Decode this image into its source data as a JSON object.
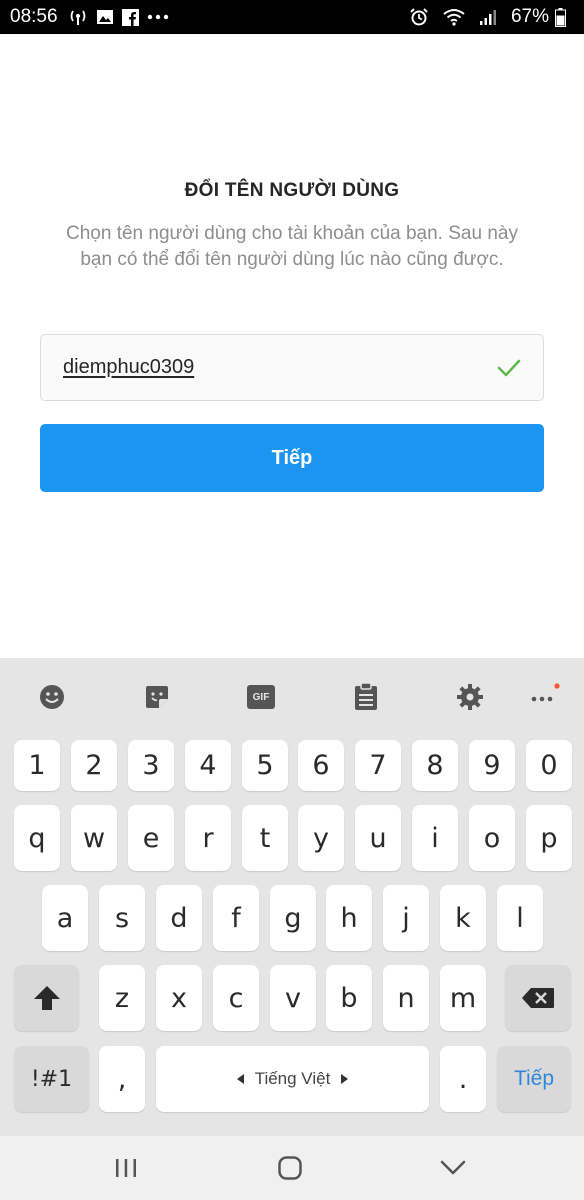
{
  "status_bar": {
    "time": "08:56",
    "battery": "67%",
    "left_icons": [
      "wifi-calling-icon",
      "image-icon",
      "facebook-icon",
      "more-dots-icon"
    ],
    "right_icons": [
      "alarm-icon",
      "wifi-icon",
      "signal-icon",
      "battery-icon"
    ]
  },
  "screen": {
    "title": "ĐỔI TÊN NGƯỜI DÙNG",
    "subtitle": "Chọn tên người dùng cho tài khoản của bạn. Sau này bạn có thể đổi tên người dùng lúc nào cũng được.",
    "username_value": "diemphuc0309",
    "next_button": "Tiếp",
    "colors": {
      "button": "#1b95f0",
      "check": "#5cba47",
      "title": "#262626",
      "subtitle": "#8e8e8e"
    }
  },
  "keyboard": {
    "toolbar_icons": [
      "emoji-icon",
      "sticker-icon",
      "gif-icon",
      "clipboard-icon",
      "settings-icon",
      "more-options-icon"
    ],
    "gif_label": "GIF",
    "number_row": [
      "1",
      "2",
      "3",
      "4",
      "5",
      "6",
      "7",
      "8",
      "9",
      "0"
    ],
    "row1": [
      "q",
      "w",
      "e",
      "r",
      "t",
      "y",
      "u",
      "i",
      "o",
      "p"
    ],
    "row2": [
      "a",
      "s",
      "d",
      "f",
      "g",
      "h",
      "j",
      "k",
      "l"
    ],
    "row3": [
      "z",
      "x",
      "c",
      "v",
      "b",
      "n",
      "m"
    ],
    "symbols_key": "!#1",
    "comma_key": ",",
    "space_label": "Tiếng Việt",
    "period_key": ".",
    "enter_label": "Tiếp"
  },
  "nav_bar": {
    "icons": [
      "recent-apps-icon",
      "home-icon",
      "back-icon"
    ]
  }
}
